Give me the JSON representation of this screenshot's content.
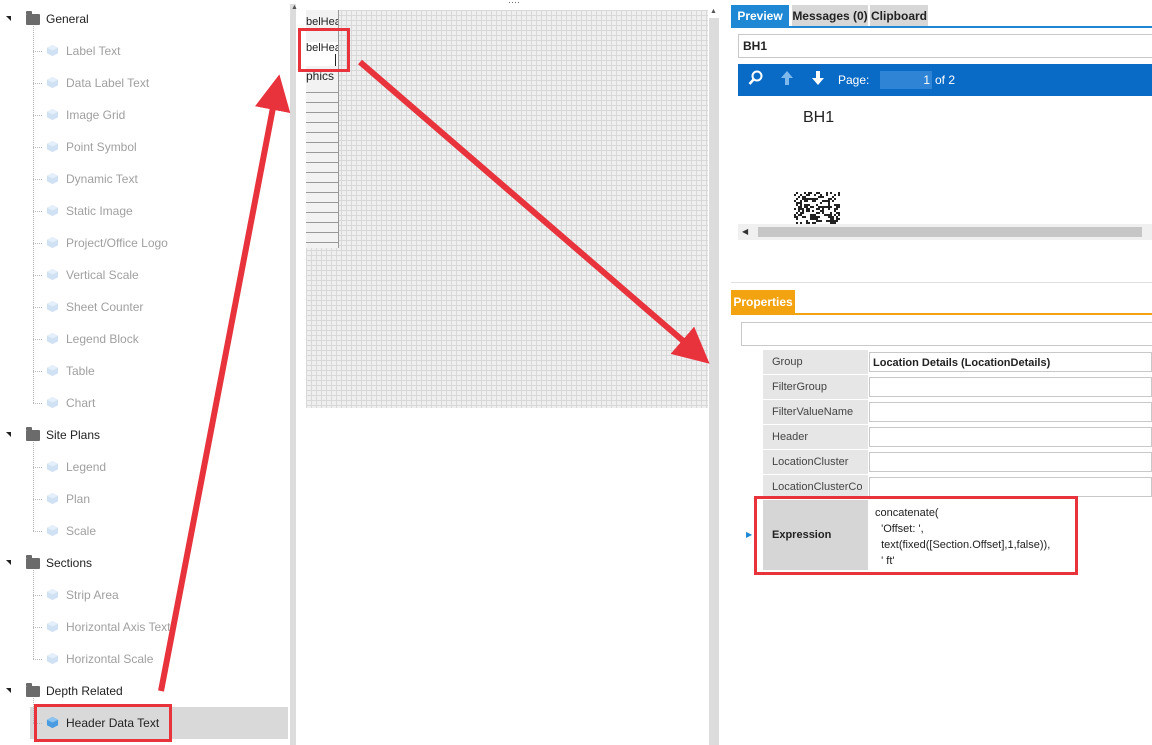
{
  "tree": {
    "groups": [
      {
        "label": "General",
        "items": [
          "Label Text",
          "Data Label Text",
          "Image Grid",
          "Point Symbol",
          "Dynamic Text",
          "Static Image",
          "Project/Office Logo",
          "Vertical Scale",
          "Sheet Counter",
          "Legend Block",
          "Table",
          "Chart"
        ]
      },
      {
        "label": "Site Plans",
        "items": [
          "Legend",
          "Plan",
          "Scale"
        ]
      },
      {
        "label": "Sections",
        "items": [
          "Strip Area",
          "Horizontal Axis Text",
          "Horizontal Scale"
        ]
      },
      {
        "label": "Depth Related",
        "items": [
          "Header Data Text"
        ]
      }
    ],
    "selected_item": "Header Data Text"
  },
  "canvas": {
    "column_texts": [
      "belHea",
      "belHea",
      "phics"
    ]
  },
  "preview": {
    "tabs": [
      "Preview",
      "Messages (0)",
      "Clipboard"
    ],
    "active_tab": "Preview",
    "document": "BH1",
    "toolbar": {
      "page_label": "Page:",
      "page_value": "1",
      "page_total": "of 2"
    },
    "content_title": "BH1"
  },
  "properties": {
    "tab_label": "Properties",
    "rows": [
      {
        "name": "Group",
        "value": "Location Details (LocationDetails)"
      },
      {
        "name": "FilterGroup",
        "value": ""
      },
      {
        "name": "FilterValueName",
        "value": ""
      },
      {
        "name": "Header",
        "value": ""
      },
      {
        "name": "LocationCluster",
        "value": ""
      },
      {
        "name": "LocationClusterCo",
        "value": ""
      }
    ],
    "expression": {
      "name": "Expression",
      "value": "concatenate(\n  'Offset: ',\n  text(fixed([Section.Offset],1,false)),\n  ' ft'"
    }
  },
  "colors": {
    "accent_blue": "#1e88d4",
    "toolbar_blue": "#0a6bc7",
    "properties_orange": "#f2a30f",
    "annotation_red": "#e8323c"
  }
}
